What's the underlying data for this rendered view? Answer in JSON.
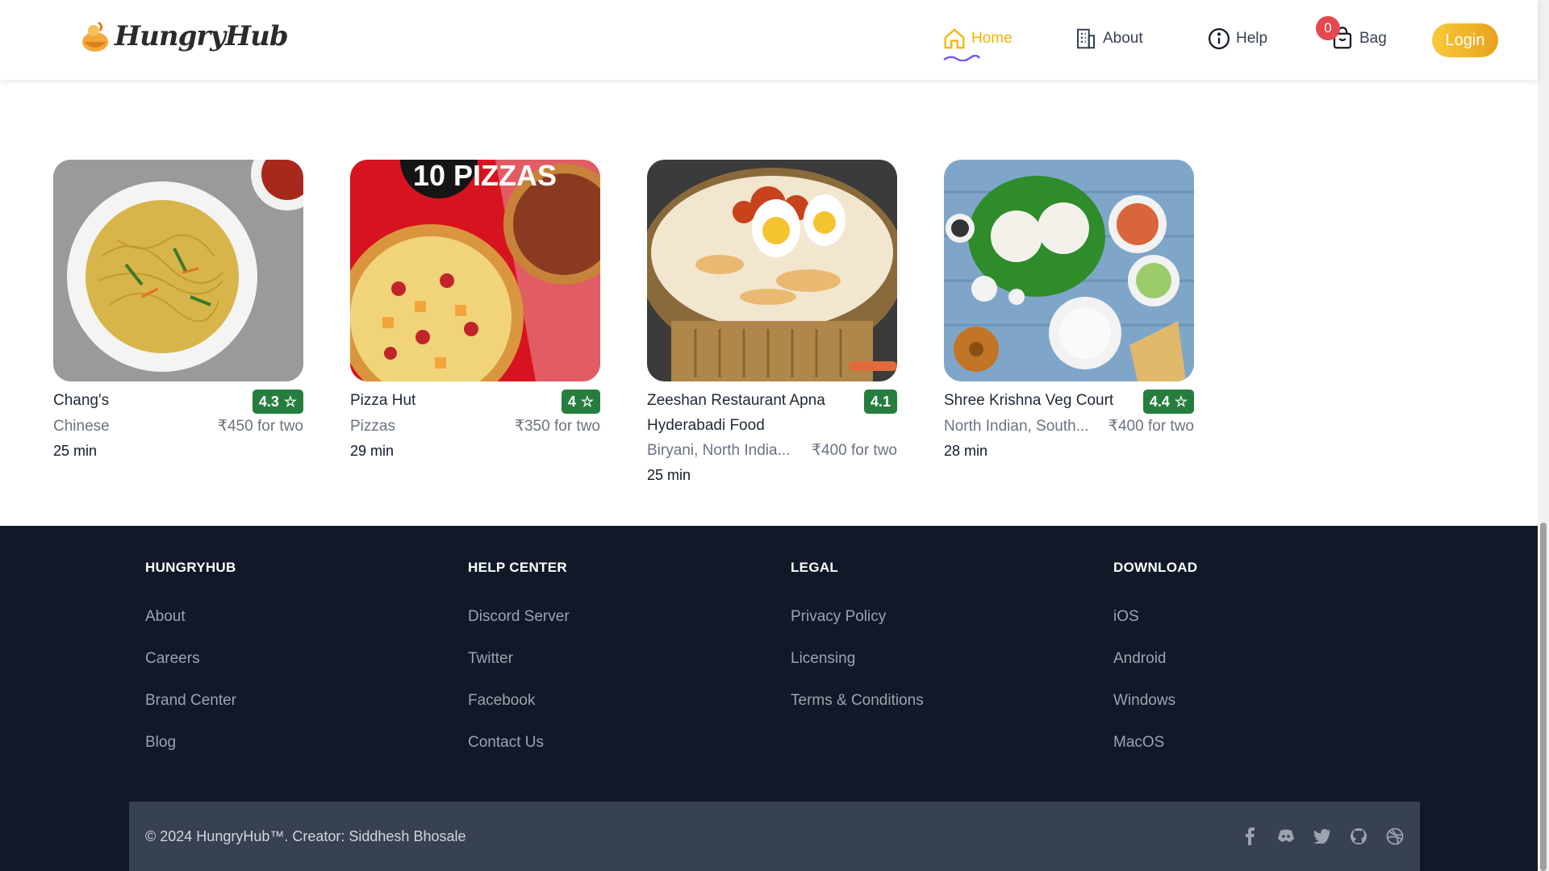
{
  "brand": {
    "name": "HungryHub"
  },
  "nav": {
    "home": "Home",
    "about": "About",
    "help": "Help",
    "bag": "Bag",
    "bag_count": "0",
    "login": "Login"
  },
  "restaurants": [
    {
      "name": "Chang's",
      "rating": "4.3",
      "cuisine": "Chinese",
      "price": "₹450 for two",
      "time": "25 min"
    },
    {
      "name": "Pizza Hut",
      "rating": "4",
      "cuisine": "Pizzas",
      "price": "₹350 for two",
      "time": "29 min",
      "image_text": "10 PIZZAS"
    },
    {
      "name": "Zeeshan Restaurant Apna Hyderabadi Food",
      "rating": "4.1",
      "cuisine": "Biryani, North India...",
      "price": "₹400 for two",
      "time": "25 min"
    },
    {
      "name": "Shree Krishna Veg Court",
      "rating": "4.4",
      "cuisine": "North Indian, South...",
      "price": "₹400 for two",
      "time": "28 min"
    }
  ],
  "footer": {
    "columns": [
      {
        "title": "HUNGRYHUB",
        "links": [
          "About",
          "Careers",
          "Brand Center",
          "Blog"
        ]
      },
      {
        "title": "HELP CENTER",
        "links": [
          "Discord Server",
          "Twitter",
          "Facebook",
          "Contact Us"
        ]
      },
      {
        "title": "LEGAL",
        "links": [
          "Privacy Policy",
          "Licensing",
          "Terms & Conditions"
        ]
      },
      {
        "title": "DOWNLOAD",
        "links": [
          "iOS",
          "Android",
          "Windows",
          "MacOS"
        ]
      }
    ],
    "copyright": "© 2024 HungryHub™. Creator: Siddhesh Bhosale",
    "socials": [
      "facebook-icon",
      "discord-icon",
      "twitter-icon",
      "github-icon",
      "dribbble-icon"
    ]
  },
  "colors": {
    "accent": "#f5b400",
    "rating": "#267e3e",
    "footer_bg": "#111827",
    "footer_bar": "#374151",
    "badge": "#e5484d"
  }
}
